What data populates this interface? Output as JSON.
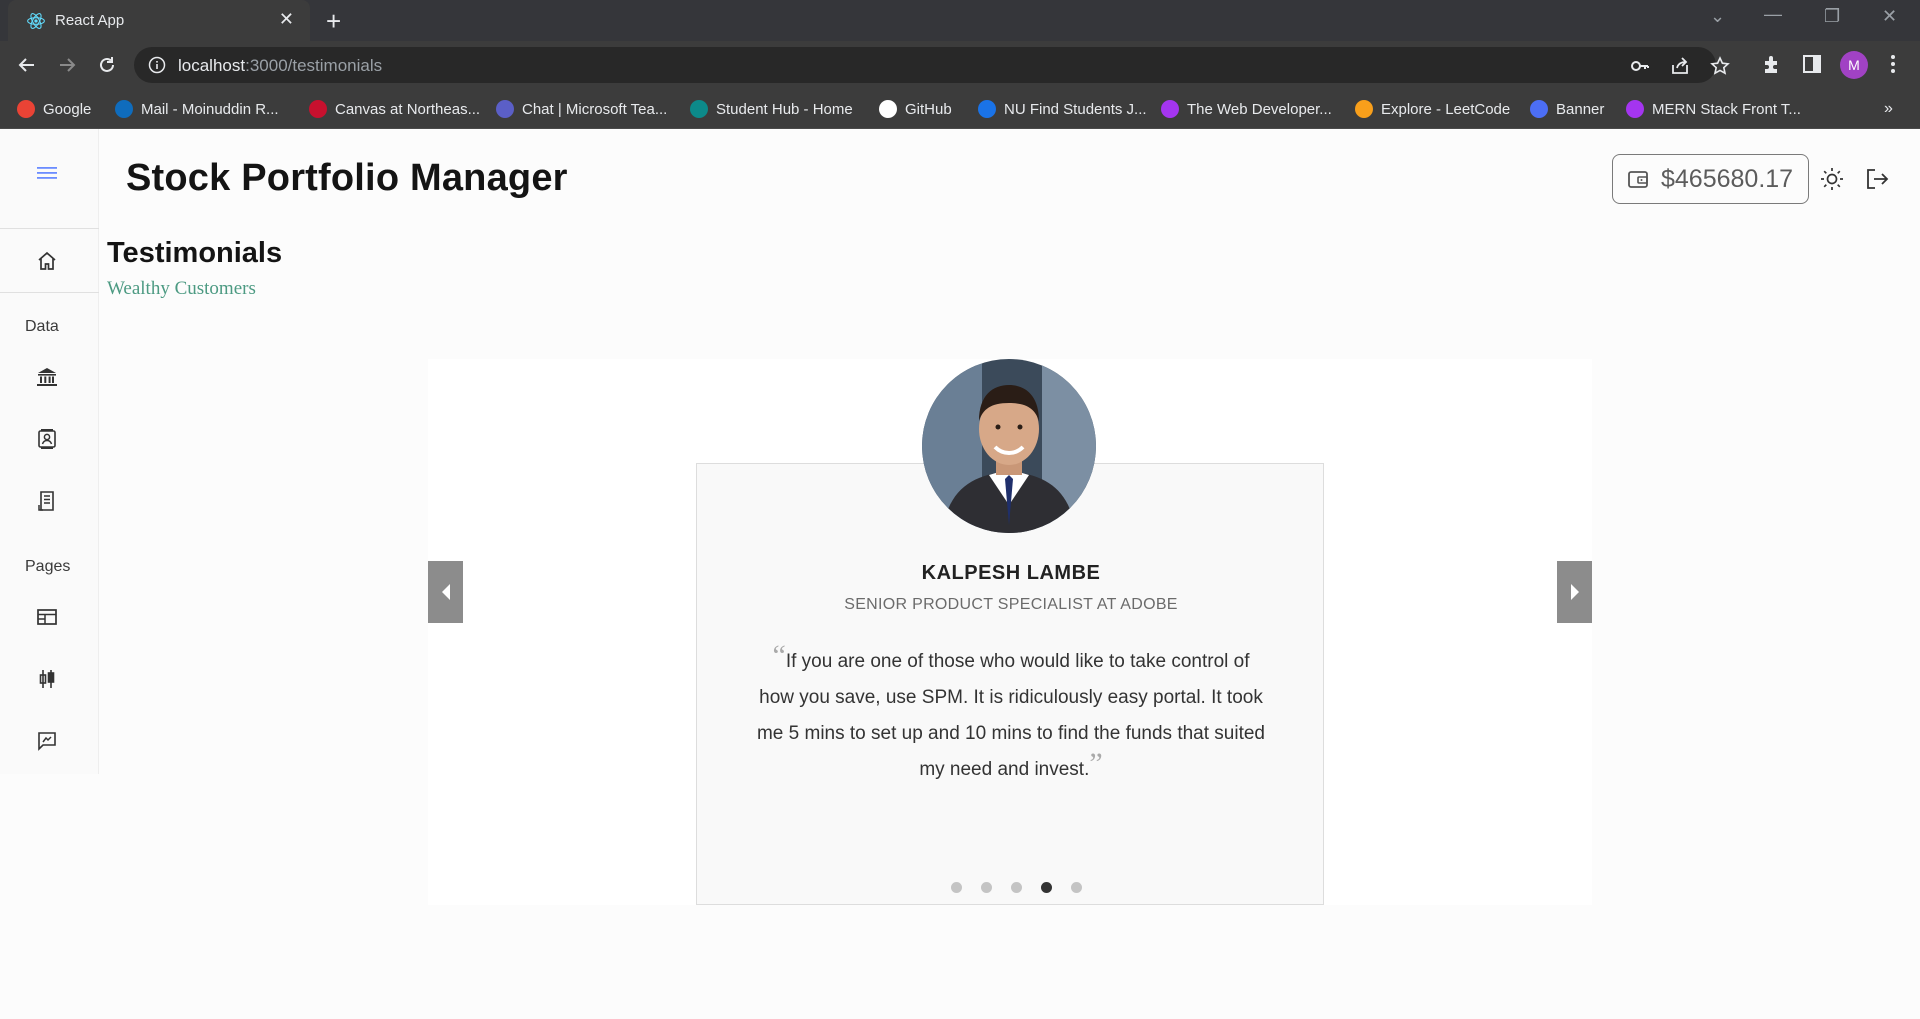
{
  "browser": {
    "tab_title": "React App",
    "url_host": "localhost",
    "url_path": ":3000/testimonials",
    "profile_initial": "M",
    "bookmarks": [
      {
        "label": "Google",
        "color": "#ea4335"
      },
      {
        "label": "Mail - Moinuddin R...",
        "color": "#0f6cbd"
      },
      {
        "label": "Canvas at Northeas...",
        "color": "#c8102e"
      },
      {
        "label": "Chat | Microsoft Tea...",
        "color": "#5b5fc7"
      },
      {
        "label": "Student Hub - Home",
        "color": "#0c8a8a"
      },
      {
        "label": "GitHub",
        "color": "#ffffff"
      },
      {
        "label": "NU Find Students J...",
        "color": "#1a73e8"
      },
      {
        "label": "The Web Developer...",
        "color": "#a435f0"
      },
      {
        "label": "Explore - LeetCode",
        "color": "#f89f1b"
      },
      {
        "label": "Banner",
        "color": "#4c6ef5"
      },
      {
        "label": "MERN Stack Front T...",
        "color": "#a435f0"
      }
    ]
  },
  "app": {
    "title": "Stock Portfolio Manager",
    "wallet_amount": "$465680.17",
    "sidebar": {
      "data_heading": "Data",
      "pages_heading": "Pages"
    },
    "section": {
      "title": "Testimonials",
      "subtitle": "Wealthy Customers"
    },
    "testimonial": {
      "name": "KALPESH LAMBE",
      "role": "SENIOR PRODUCT SPECIALIST AT ADOBE",
      "quote": "If you are one of those who would like to take control of how you save, use SPM. It is ridiculously easy portal. It took me 5 mins to set up and 10 mins to find the funds that suited my need and invest.",
      "open_quote": "“",
      "close_quote": "”",
      "active_index": 4,
      "total": 5
    }
  },
  "colors": {
    "accent_green": "#4c9a82",
    "menu_icon_blue": "#6b8cff"
  }
}
